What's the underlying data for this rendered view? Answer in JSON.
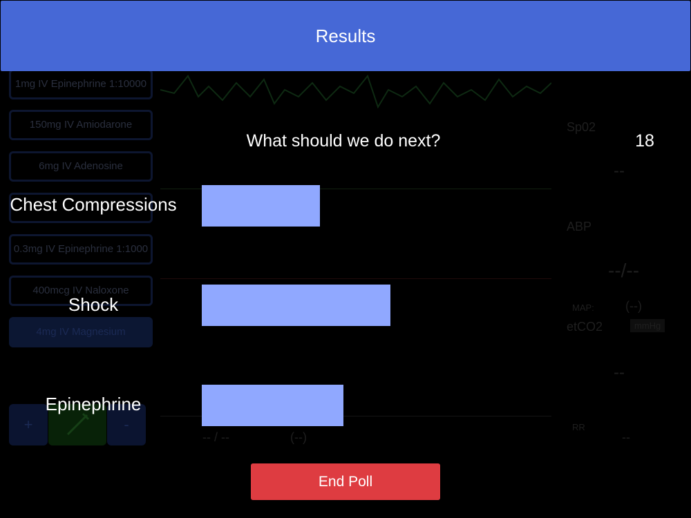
{
  "header": {
    "title": "Results"
  },
  "poll": {
    "question": "What should we do next?",
    "total": "18",
    "options": [
      {
        "label": "Chest Compressions",
        "votes": 5
      },
      {
        "label": "Shock",
        "votes": 8
      },
      {
        "label": "Epinephrine",
        "votes": 6
      }
    ],
    "bar_color": "#90a8ff",
    "end_button": "End Poll",
    "end_button_color": "#de3c41",
    "header_color": "#4668d6"
  },
  "background": {
    "drugs": [
      "1mg IV Epinephrine 1:10000",
      "150mg IV Amiodarone",
      "6mg IV Adenosine",
      "",
      "0.3mg IV Epinephrine 1:1000",
      "400mcg IV Naloxone",
      "4mg IV Magnesium"
    ],
    "controls": {
      "plus": "+",
      "minus": "-"
    },
    "vitals": {
      "spo2_label": "Sp02",
      "spo2_value": "--",
      "abp_label": "ABP",
      "abp_value": "--/--",
      "map_label": "MAP:",
      "map_value": "(--)",
      "etco2_label": "etCO2",
      "unit": "mmHg",
      "etco2_value": "--",
      "rr_label": "RR",
      "rr_value": "--",
      "bottom_readout": "-- / --",
      "bottom_paren": "(--)"
    }
  }
}
